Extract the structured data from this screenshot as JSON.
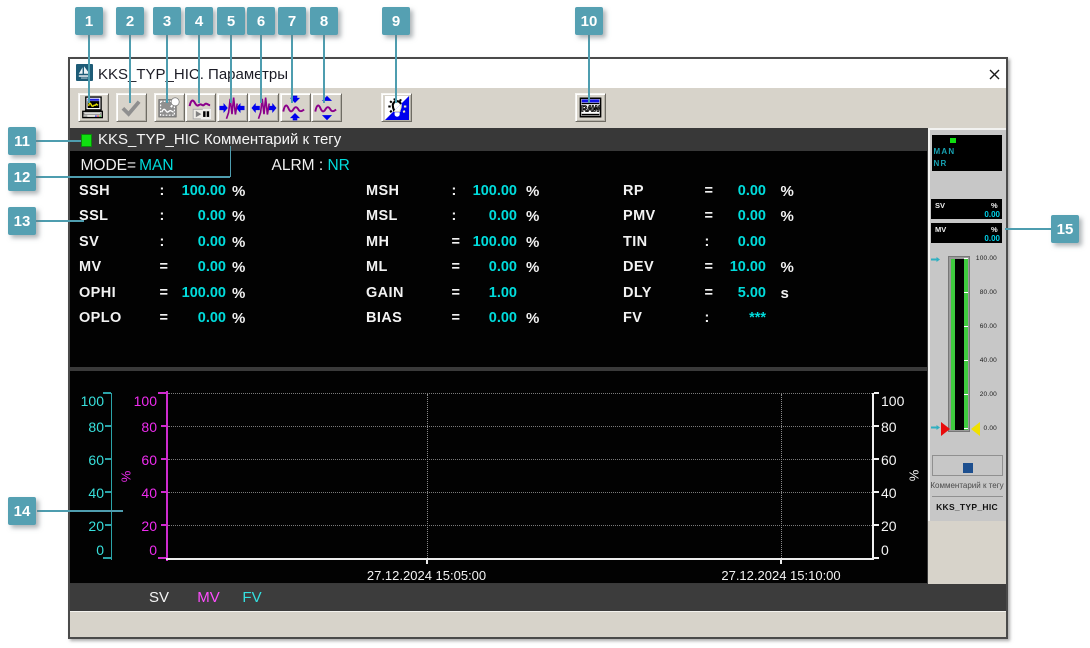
{
  "callouts": {
    "labels": [
      "1",
      "2",
      "3",
      "4",
      "5",
      "6",
      "7",
      "8",
      "9",
      "10",
      "11",
      "12",
      "13",
      "14",
      "15"
    ]
  },
  "window": {
    "title": "KKS_TYP_HIC. Параметры",
    "close_glyph": "×"
  },
  "toolbar": {
    "buttons": [
      {
        "name": "print"
      },
      {
        "name": "confirm"
      },
      {
        "name": "snapshot"
      },
      {
        "name": "run-pause-trend"
      },
      {
        "name": "compress-time-axis"
      },
      {
        "name": "expand-time-axis"
      },
      {
        "name": "compress-value-axis"
      },
      {
        "name": "expand-value-axis"
      },
      {
        "name": "invert-colors"
      },
      {
        "name": "raw-data-window"
      }
    ]
  },
  "tag_header": {
    "text": "KKS_TYP_HIC Комментарий к тегу"
  },
  "mode_row": {
    "mode_label": "MODE=",
    "mode_value": "MAN",
    "alrm_label": "ALRM : ",
    "alrm_value": "NR"
  },
  "parameters": {
    "col1": [
      {
        "name": "SSH",
        "sep": ":",
        "value": "100.00",
        "unit": "%"
      },
      {
        "name": "SSL",
        "sep": ":",
        "value": "0.00",
        "unit": "%"
      },
      {
        "name": "SV",
        "sep": ":",
        "value": "0.00",
        "unit": "%"
      },
      {
        "name": "MV",
        "sep": "=",
        "value": "0.00",
        "unit": "%"
      },
      {
        "name": "OPHI",
        "sep": "=",
        "value": "100.00",
        "unit": "%"
      },
      {
        "name": "OPLO",
        "sep": "=",
        "value": "0.00",
        "unit": "%"
      }
    ],
    "col2": [
      {
        "name": "MSH",
        "sep": ":",
        "value": "100.00",
        "unit": "%"
      },
      {
        "name": "MSL",
        "sep": ":",
        "value": "0.00",
        "unit": "%"
      },
      {
        "name": "MH",
        "sep": "=",
        "value": "100.00",
        "unit": "%"
      },
      {
        "name": "ML",
        "sep": "=",
        "value": "0.00",
        "unit": "%"
      },
      {
        "name": "GAIN",
        "sep": "=",
        "value": "1.00",
        "unit": ""
      },
      {
        "name": "BIAS",
        "sep": "=",
        "value": "0.00",
        "unit": "%"
      }
    ],
    "col3": [
      {
        "name": "RP",
        "sep": "=",
        "value": "0.00",
        "unit": "%"
      },
      {
        "name": "PMV",
        "sep": "=",
        "value": "0.00",
        "unit": "%"
      },
      {
        "name": "TIN",
        "sep": ":",
        "value": "0.00",
        "unit": ""
      },
      {
        "name": "DEV",
        "sep": "=",
        "value": "10.00",
        "unit": "%"
      },
      {
        "name": "DLY",
        "sep": "=",
        "value": "5.00",
        "unit": "s"
      },
      {
        "name": "FV",
        "sep": ":",
        "value": "***",
        "unit": ""
      }
    ]
  },
  "chart_data": {
    "type": "line",
    "title": "",
    "x_labels": [
      "27.12.2024 15:05:00",
      "27.12.2024 15:10:00"
    ],
    "y_ticks": [
      "100",
      "80",
      "60",
      "40",
      "20",
      "0"
    ],
    "ylim": [
      0,
      100
    ],
    "axes": [
      {
        "name": "FV",
        "color": "#38E0DC",
        "unit": ""
      },
      {
        "name": "MV",
        "color": "#EE2CEE",
        "unit": "%"
      },
      {
        "name": "SV",
        "color": "#F5F5F5",
        "unit": "%"
      }
    ],
    "series": [
      {
        "name": "SV",
        "color": "#F5F5F5",
        "values": []
      },
      {
        "name": "MV",
        "color": "#FF4DFF",
        "values": []
      },
      {
        "name": "FV",
        "color": "#35E0E0",
        "values": []
      }
    ],
    "legend": [
      "SV",
      "MV",
      "FV"
    ],
    "grid": true
  },
  "trend": {
    "ticks": [
      "100",
      "80",
      "60",
      "40",
      "20",
      "0"
    ],
    "unit_mv": "%",
    "unit_sv": "%",
    "timestamps": [
      "27.12.2024 15:05:00",
      "27.12.2024 15:10:00"
    ],
    "legend": {
      "sv": "SV",
      "mv": "MV",
      "fv": "FV"
    }
  },
  "faceplate": {
    "mode": "MAN",
    "alarm": "NR",
    "sv": {
      "label": "SV",
      "unit": "%",
      "value": "0.00"
    },
    "mv": {
      "label": "MV",
      "unit": "%",
      "value": "0.00"
    },
    "scale": [
      "100.00",
      "80.00",
      "60.00",
      "40.00",
      "20.00",
      "0.00"
    ],
    "comment": "Комментарий к тегу",
    "tag": "KKS_TYP_HIC"
  }
}
